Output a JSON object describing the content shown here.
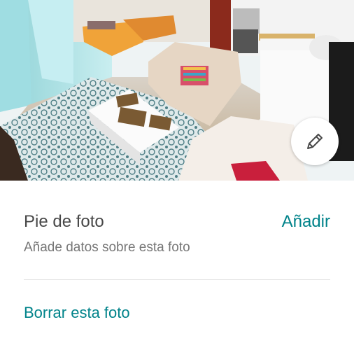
{
  "photo": {
    "alt_icon": "photo-living-room",
    "edit_icon": "pencil-icon"
  },
  "caption": {
    "title": "Pie de foto",
    "add_label": "Añadir",
    "hint": "Añade datos sobre esta foto"
  },
  "actions": {
    "delete_label": "Borrar esta foto"
  },
  "colors": {
    "accent": "#00838a",
    "title_text": "#484848",
    "hint_text": "#767676",
    "divider": "#e4e4e4"
  }
}
